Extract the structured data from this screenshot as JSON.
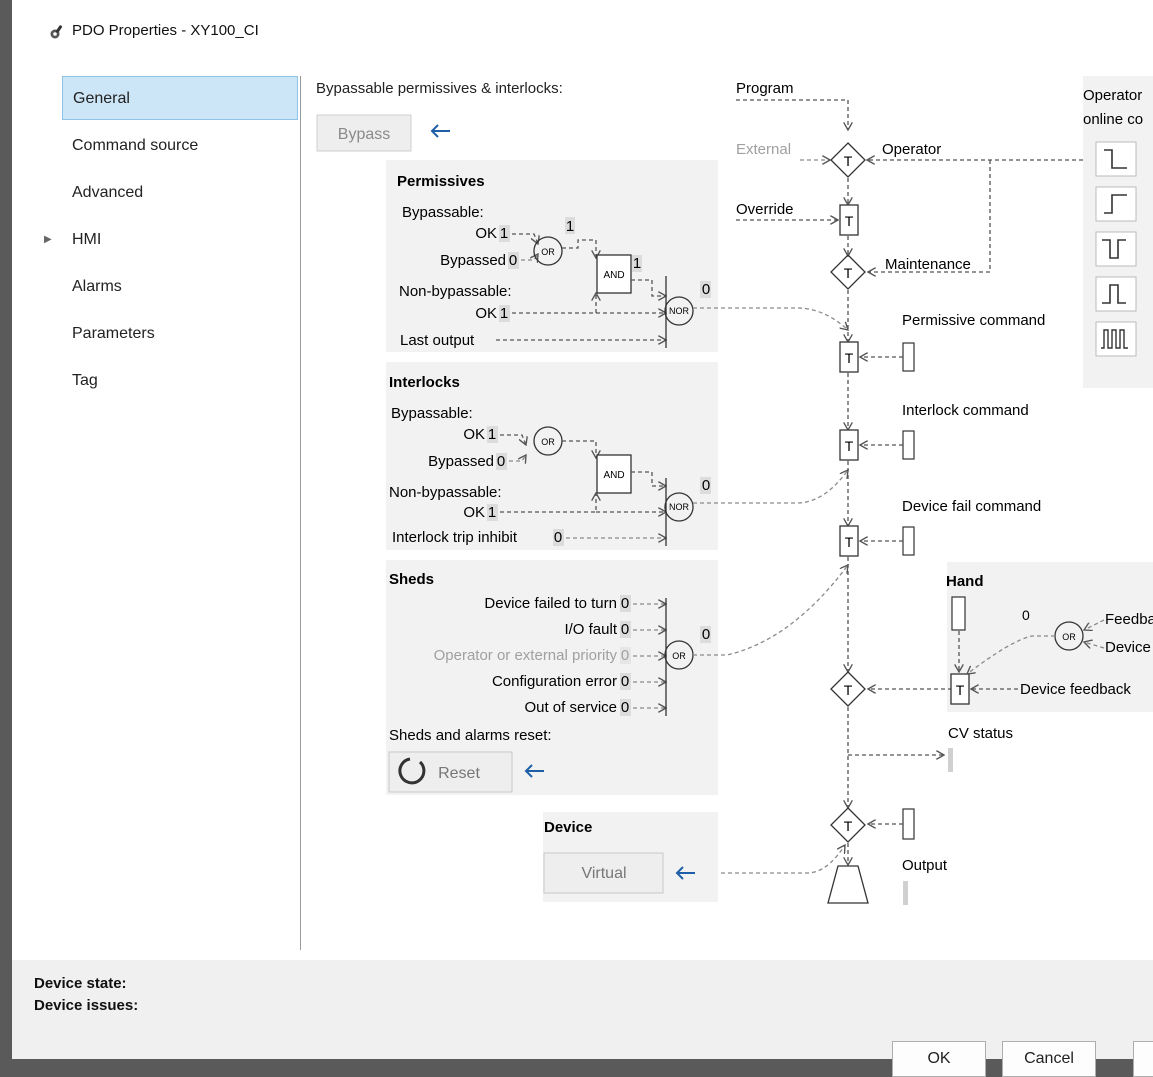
{
  "window": {
    "title": "PDO Properties - XY100_CI"
  },
  "sidebar": {
    "items": [
      {
        "label": "General"
      },
      {
        "label": "Command source"
      },
      {
        "label": "Advanced"
      },
      {
        "label": "HMI"
      },
      {
        "label": "Alarms"
      },
      {
        "label": "Parameters"
      },
      {
        "label": "Tag"
      }
    ]
  },
  "bypass": {
    "heading": "Bypassable permissives & interlocks:",
    "button_label": "Bypass"
  },
  "permissives": {
    "title": "Permissives",
    "bypassable_label": "Bypassable:",
    "ok_label": "OK",
    "ok_value": "1",
    "or_out": "1",
    "bypassed_label": "Bypassed",
    "bypassed_value": "0",
    "and_out": "1",
    "non_bypassable_label": "Non-bypassable:",
    "nb_ok_label": "OK",
    "nb_ok_value": "1",
    "nor_out": "0",
    "last_output_label": "Last output"
  },
  "interlocks": {
    "title": "Interlocks",
    "bypassable_label": "Bypassable:",
    "ok_label": "OK",
    "ok_value": "1",
    "bypassed_label": "Bypassed",
    "bypassed_value": "0",
    "non_bypassable_label": "Non-bypassable:",
    "nb_ok_label": "OK",
    "nb_ok_value": "1",
    "nor_out": "0",
    "trip_inhibit_label": "Interlock trip inhibit",
    "trip_inhibit_value": "0"
  },
  "sheds": {
    "title": "Sheds",
    "items": [
      {
        "label": "Device failed to turn",
        "value": "0"
      },
      {
        "label": "I/O fault",
        "value": "0"
      },
      {
        "label": "Operator or external priority",
        "value": "0"
      },
      {
        "label": "Configuration error",
        "value": "0"
      },
      {
        "label": "Out of service",
        "value": "0"
      }
    ],
    "or_out": "0",
    "reset_heading": "Sheds and alarms reset:",
    "reset_label": "Reset"
  },
  "device": {
    "title": "Device",
    "button_label": "Virtual"
  },
  "gates": {
    "and": "AND",
    "or": "OR",
    "nor": "NOR",
    "track": "T"
  },
  "flow": {
    "program": "Program",
    "external": "External",
    "operator": "Operator",
    "override": "Override",
    "maintenance": "Maintenance",
    "permissive_command": "Permissive command",
    "interlock_command": "Interlock command",
    "device_fail_command": "Device fail command",
    "cv_status": "CV status",
    "output": "Output"
  },
  "operator_panel": {
    "line1": "Operator",
    "line2": "online co"
  },
  "hand": {
    "title": "Hand",
    "or_out": "0",
    "feedback_label": "Feedba",
    "device_label": "Device",
    "device_feedback_label": "Device feedback"
  },
  "footer": {
    "device_state_label": "Device state:",
    "device_issues_label": "Device issues:",
    "ok_label": "OK",
    "cancel_label": "Cancel"
  },
  "colors": {
    "accent": "#1f5fa8",
    "selection": "#cde6f7",
    "panel": "#f2f2f2"
  }
}
